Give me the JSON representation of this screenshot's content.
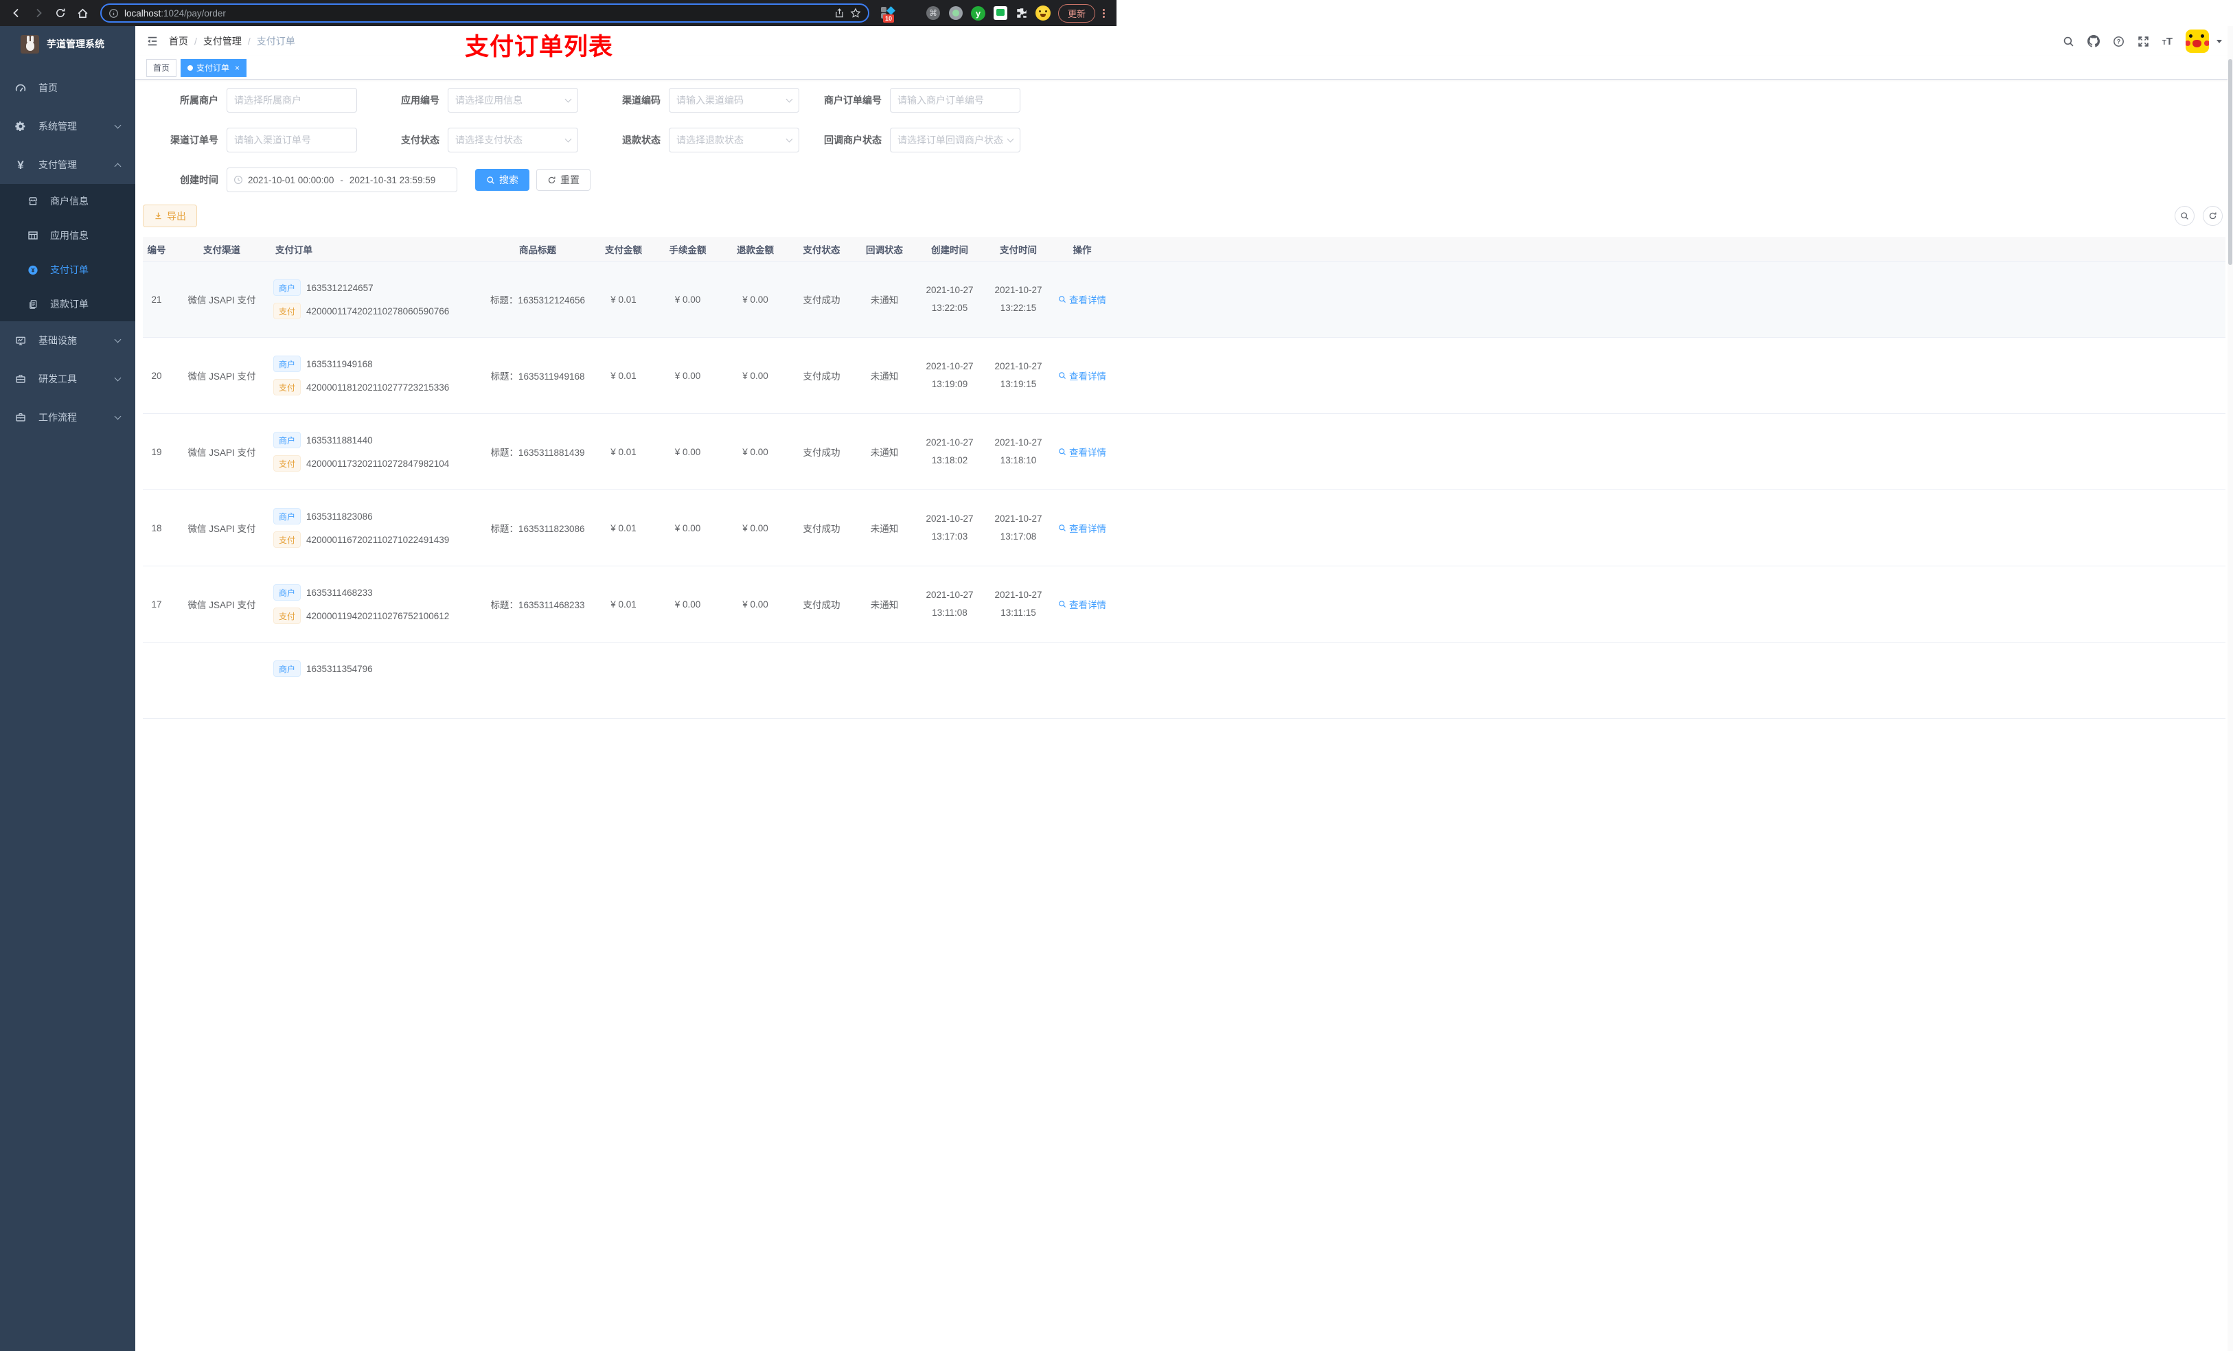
{
  "browser": {
    "url": {
      "host": "localhost",
      "path": ":1024/pay/order"
    },
    "badge_count": "10",
    "update_label": "更新"
  },
  "sidebar": {
    "title": "芋道管理系统",
    "menu": [
      {
        "label": "首页",
        "icon": "dashboard",
        "type": "item"
      },
      {
        "label": "系统管理",
        "icon": "gear",
        "type": "group",
        "state": "collapsed"
      },
      {
        "label": "支付管理",
        "icon": "yen",
        "type": "group",
        "state": "expanded"
      },
      {
        "label": "商户信息",
        "icon": "store",
        "type": "subitem",
        "active": false
      },
      {
        "label": "应用信息",
        "icon": "grid",
        "type": "subitem",
        "active": false
      },
      {
        "label": "支付订单",
        "icon": "yen-circle",
        "type": "subitem",
        "active": true
      },
      {
        "label": "退款订单",
        "icon": "document",
        "type": "subitem",
        "active": false
      },
      {
        "label": "基础设施",
        "icon": "monitor",
        "type": "group",
        "state": "collapsed"
      },
      {
        "label": "研发工具",
        "icon": "toolbox",
        "type": "group",
        "state": "collapsed"
      },
      {
        "label": "工作流程",
        "icon": "toolbox",
        "type": "group",
        "state": "collapsed"
      }
    ]
  },
  "header": {
    "breadcrumb": [
      "首页",
      "支付管理",
      "支付订单"
    ],
    "annotation": "支付订单列表"
  },
  "tabs": [
    {
      "label": "首页",
      "active": false
    },
    {
      "label": "支付订单",
      "active": true
    }
  ],
  "filters": {
    "fields": [
      {
        "label": "所属商户",
        "placeholder": "请选择所属商户",
        "type": "input"
      },
      {
        "label": "应用编号",
        "placeholder": "请选择应用信息",
        "type": "select"
      },
      {
        "label": "渠道编码",
        "placeholder": "请输入渠道编码",
        "type": "select"
      },
      {
        "label": "商户订单编号",
        "placeholder": "请输入商户订单编号",
        "type": "input"
      },
      {
        "label": "渠道订单号",
        "placeholder": "请输入渠道订单号",
        "type": "input"
      },
      {
        "label": "支付状态",
        "placeholder": "请选择支付状态",
        "type": "select"
      },
      {
        "label": "退款状态",
        "placeholder": "请选择退款状态",
        "type": "select"
      },
      {
        "label": "回调商户状态",
        "placeholder": "请选择订单回调商户状态",
        "type": "select"
      }
    ],
    "date": {
      "label": "创建时间",
      "start": "2021-10-01 00:00:00",
      "separator": "-",
      "end": "2021-10-31 23:59:59"
    },
    "search_label": "搜索",
    "reset_label": "重置"
  },
  "toolbar": {
    "export_label": "导出"
  },
  "table": {
    "tag_merchant": "商户",
    "tag_pay": "支付",
    "columns": [
      "编号",
      "支付渠道",
      "支付订单",
      "商品标题",
      "支付金额",
      "手续金额",
      "退款金额",
      "支付状态",
      "回调状态",
      "创建时间",
      "支付时间",
      "操作"
    ],
    "rows": [
      {
        "id": "21",
        "channel": "微信 JSAPI 支付",
        "merchant_no": "1635312124657",
        "pay_no": "4200001174202110278060590766",
        "title": "标题：1635312124656",
        "pay_amount": "¥ 0.01",
        "fee_amount": "¥ 0.00",
        "refund_amount": "¥ 0.00",
        "pay_status": "支付成功",
        "notify_status": "未通知",
        "create_date": "2021-10-27",
        "create_time": "13:22:05",
        "pay_date": "2021-10-27",
        "pay_time": "13:22:15",
        "action": "查看详情"
      },
      {
        "id": "20",
        "channel": "微信 JSAPI 支付",
        "merchant_no": "1635311949168",
        "pay_no": "4200001181202110277723215336",
        "title": "标题：1635311949168",
        "pay_amount": "¥ 0.01",
        "fee_amount": "¥ 0.00",
        "refund_amount": "¥ 0.00",
        "pay_status": "支付成功",
        "notify_status": "未通知",
        "create_date": "2021-10-27",
        "create_time": "13:19:09",
        "pay_date": "2021-10-27",
        "pay_time": "13:19:15",
        "action": "查看详情"
      },
      {
        "id": "19",
        "channel": "微信 JSAPI 支付",
        "merchant_no": "1635311881440",
        "pay_no": "4200001173202110272847982104",
        "title": "标题：1635311881439",
        "pay_amount": "¥ 0.01",
        "fee_amount": "¥ 0.00",
        "refund_amount": "¥ 0.00",
        "pay_status": "支付成功",
        "notify_status": "未通知",
        "create_date": "2021-10-27",
        "create_time": "13:18:02",
        "pay_date": "2021-10-27",
        "pay_time": "13:18:10",
        "action": "查看详情"
      },
      {
        "id": "18",
        "channel": "微信 JSAPI 支付",
        "merchant_no": "1635311823086",
        "pay_no": "4200001167202110271022491439",
        "title": "标题：1635311823086",
        "pay_amount": "¥ 0.01",
        "fee_amount": "¥ 0.00",
        "refund_amount": "¥ 0.00",
        "pay_status": "支付成功",
        "notify_status": "未通知",
        "create_date": "2021-10-27",
        "create_time": "13:17:03",
        "pay_date": "2021-10-27",
        "pay_time": "13:17:08",
        "action": "查看详情"
      },
      {
        "id": "17",
        "channel": "微信 JSAPI 支付",
        "merchant_no": "1635311468233",
        "pay_no": "4200001194202110276752100612",
        "title": "标题：1635311468233",
        "pay_amount": "¥ 0.01",
        "fee_amount": "¥ 0.00",
        "refund_amount": "¥ 0.00",
        "pay_status": "支付成功",
        "notify_status": "未通知",
        "create_date": "2021-10-27",
        "create_time": "13:11:08",
        "pay_date": "2021-10-27",
        "pay_time": "13:11:15",
        "action": "查看详情"
      },
      {
        "id": "",
        "channel": "",
        "merchant_no": "1635311354796",
        "pay_no": "",
        "title": "",
        "pay_amount": "",
        "fee_amount": "",
        "refund_amount": "",
        "pay_status": "",
        "notify_status": "",
        "create_date": "",
        "create_time": "",
        "pay_date": "",
        "pay_time": "",
        "action": ""
      }
    ]
  }
}
